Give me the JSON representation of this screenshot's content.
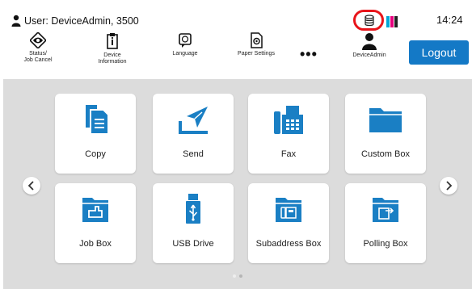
{
  "status_bar": {
    "user_text": "User: DeviceAdmin, 3500",
    "time": "14:24",
    "toner_colors": [
      "#00a6d6",
      "#e6007e",
      "#222222"
    ],
    "highlight_color": "#e8141a"
  },
  "toolbar": {
    "items": [
      {
        "label": "Status/\nJob Cancel",
        "icon": "status-eye-icon"
      },
      {
        "label": "Device\nInformation",
        "icon": "device-info-icon"
      },
      {
        "label": "Language",
        "icon": "language-icon"
      },
      {
        "label": "Paper Settings",
        "icon": "paper-settings-icon"
      },
      {
        "label": "DeviceAdmin",
        "icon": "user-icon"
      }
    ],
    "more_label": "•••",
    "logout_label": "Logout"
  },
  "tiles": [
    {
      "label": "Copy",
      "icon": "copy-icon"
    },
    {
      "label": "Send",
      "icon": "send-icon"
    },
    {
      "label": "Fax",
      "icon": "fax-icon"
    },
    {
      "label": "Custom Box",
      "icon": "folder-icon"
    },
    {
      "label": "Job Box",
      "icon": "job-box-icon"
    },
    {
      "label": "USB Drive",
      "icon": "usb-drive-icon"
    },
    {
      "label": "Subaddress Box",
      "icon": "subaddress-box-icon"
    },
    {
      "label": "Polling Box",
      "icon": "polling-box-icon"
    }
  ],
  "page_indicator": {
    "total": 2,
    "current": 1
  },
  "colors": {
    "accent": "#1479c6",
    "tile_icon": "#1a7fc4",
    "panel_bg": "#dcdcdc"
  }
}
